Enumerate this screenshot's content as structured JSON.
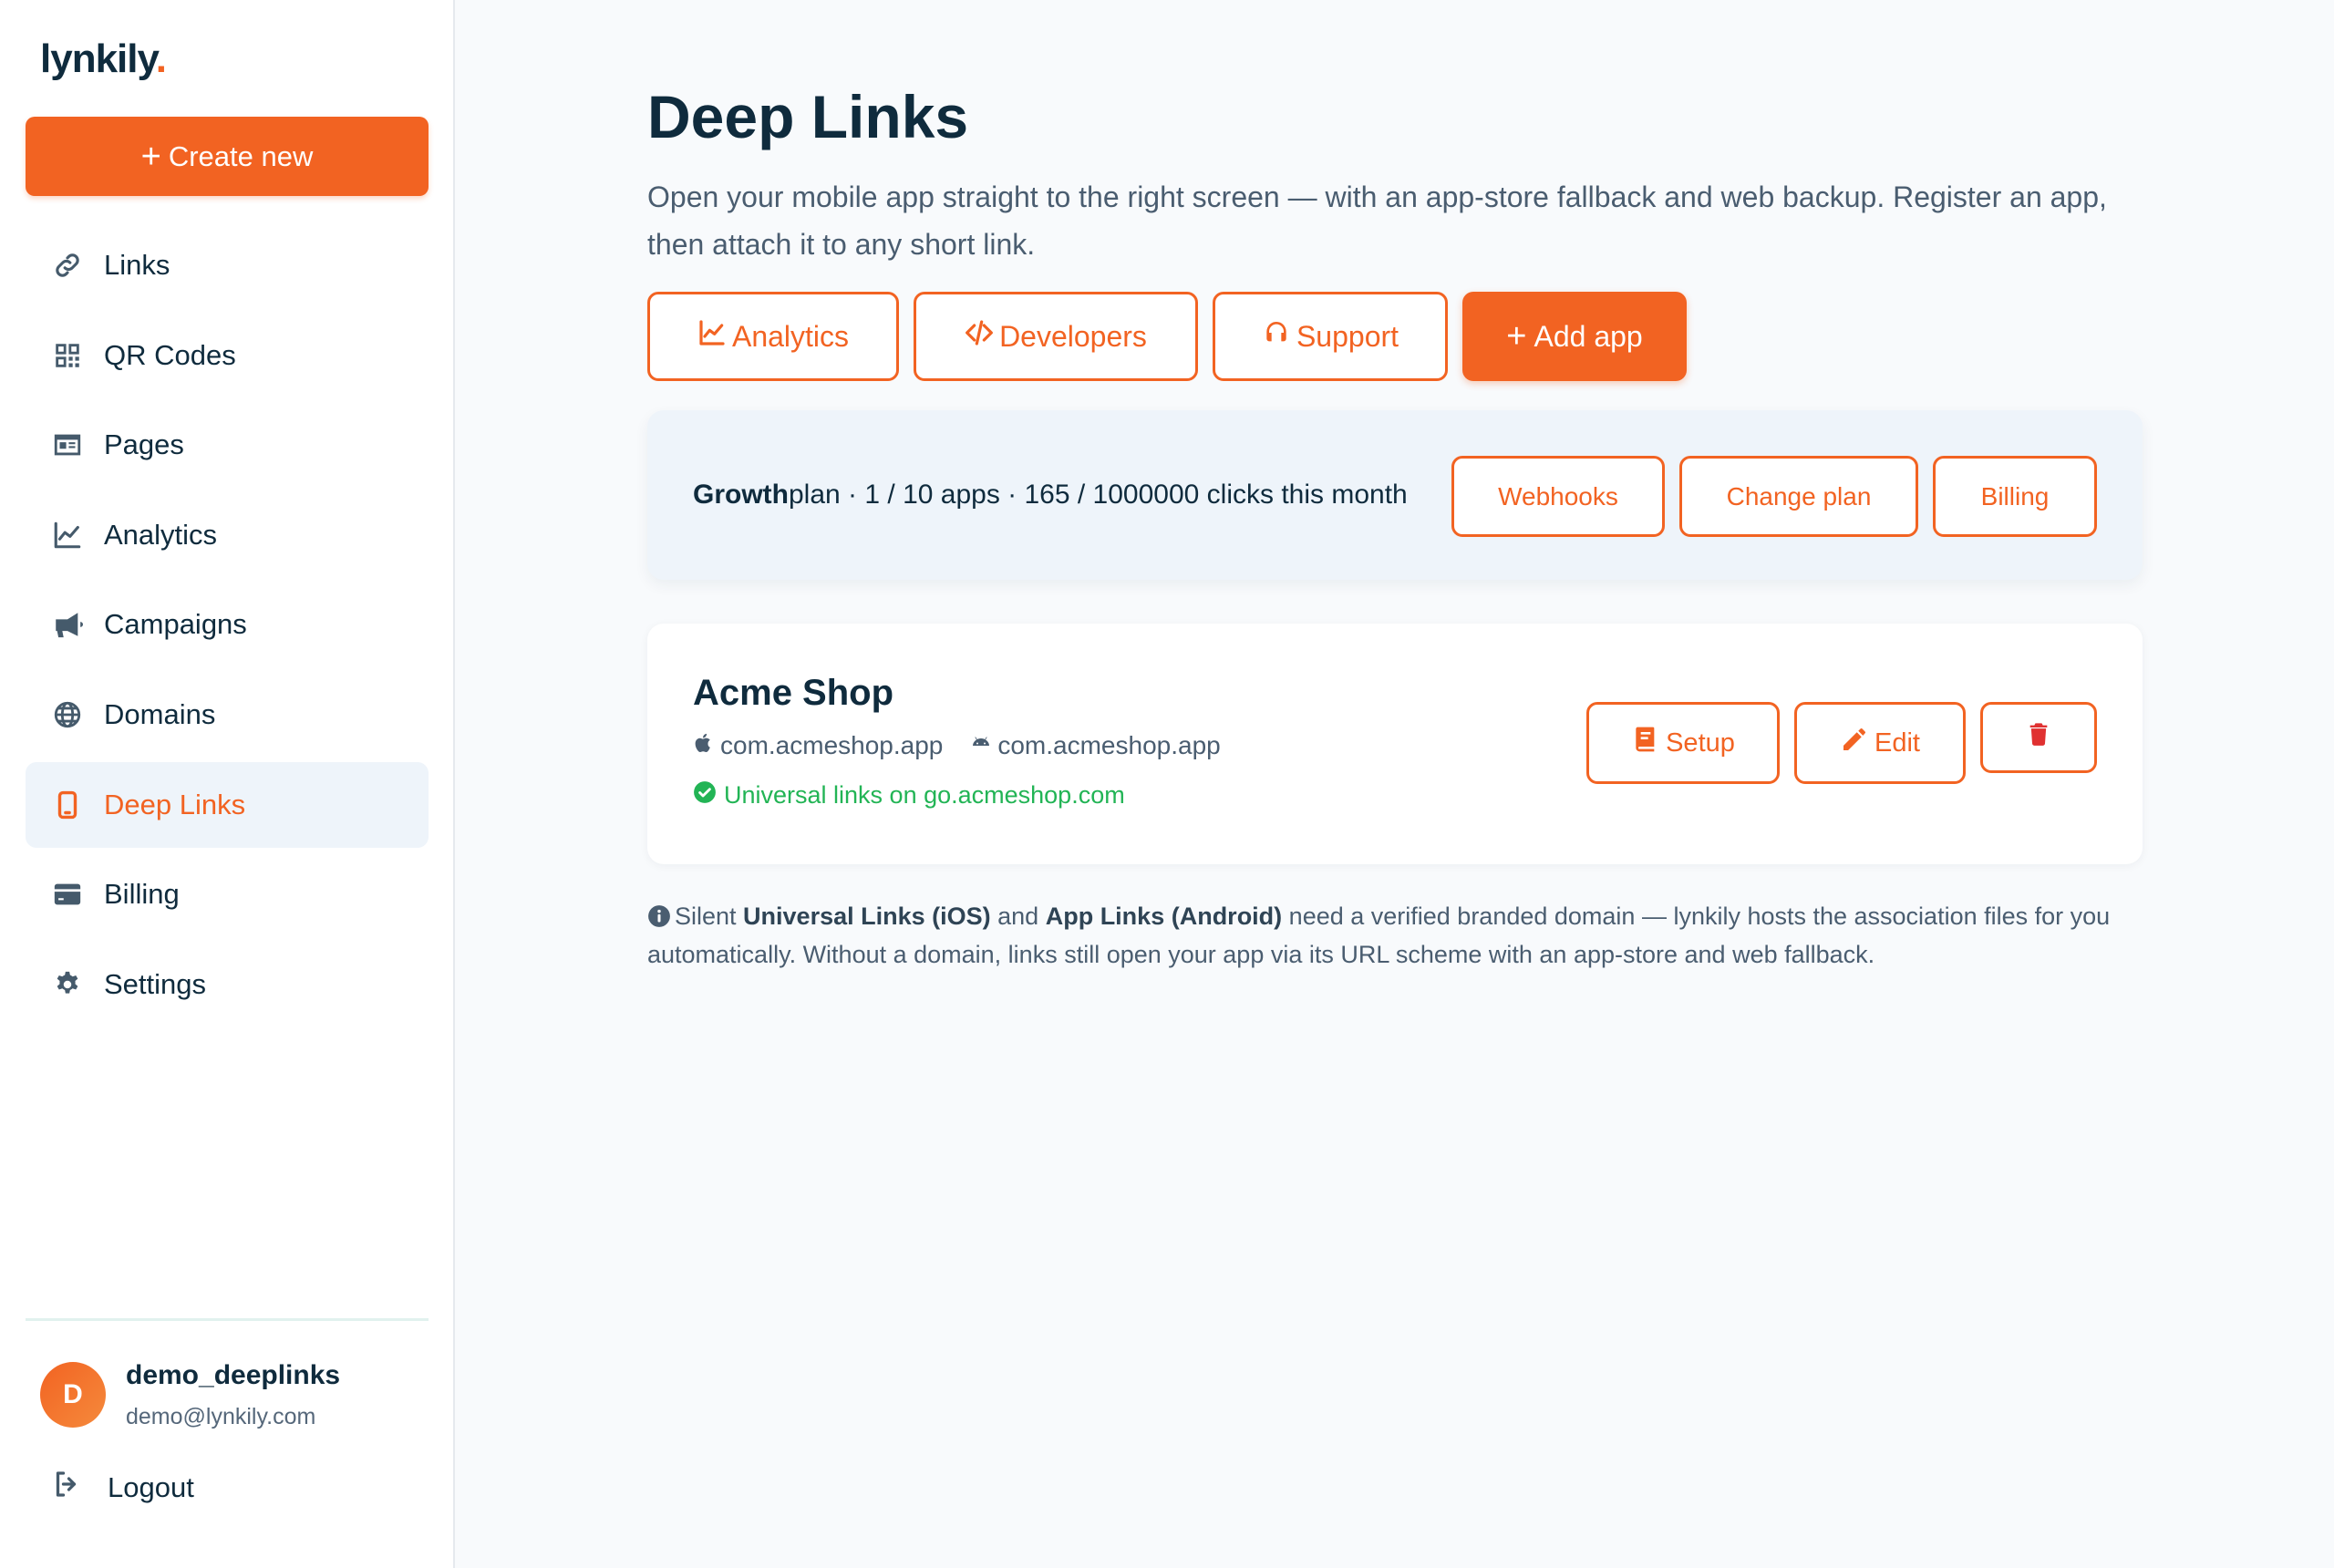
{
  "brand": {
    "name": "lynkily",
    "dot": "."
  },
  "sidebar": {
    "create_label": "Create new",
    "items": [
      {
        "label": "Links",
        "icon": "link-icon",
        "active": false
      },
      {
        "label": "QR Codes",
        "icon": "qr-code-icon",
        "active": false
      },
      {
        "label": "Pages",
        "icon": "id-card-icon",
        "active": false
      },
      {
        "label": "Analytics",
        "icon": "chart-line-icon",
        "active": false
      },
      {
        "label": "Campaigns",
        "icon": "megaphone-icon",
        "active": false
      },
      {
        "label": "Domains",
        "icon": "globe-icon",
        "active": false
      },
      {
        "label": "Deep Links",
        "icon": "mobile-icon",
        "active": true
      },
      {
        "label": "Billing",
        "icon": "credit-card-icon",
        "active": false
      },
      {
        "label": "Settings",
        "icon": "gear-icon",
        "active": false
      }
    ],
    "user": {
      "initial": "D",
      "name": "demo_deeplinks",
      "email": "demo@lynkily.com"
    },
    "logout_label": "Logout"
  },
  "page": {
    "title": "Deep Links",
    "subtitle": "Open your mobile app straight to the right screen — with an app-store fallback and web backup. Register an app, then attach it to any short link.",
    "actions": {
      "analytics": "Analytics",
      "developers": "Developers",
      "support": "Support",
      "add_app": "Add app"
    }
  },
  "plan": {
    "name": "Growth",
    "suffix": " plan · 1 / 10 apps · 165 / 1000000 clicks this month",
    "buttons": {
      "webhooks": "Webhooks",
      "change_plan": "Change plan",
      "billing": "Billing"
    }
  },
  "app": {
    "name": "Acme Shop",
    "ios_package": "com.acmeshop.app",
    "android_package": "com.acmeshop.app",
    "universal_status": "Universal links on go.acmeshop.com",
    "buttons": {
      "setup": "Setup",
      "edit": "Edit"
    }
  },
  "note": {
    "p1": "Silent ",
    "b1": "Universal Links (iOS)",
    "p2": " and ",
    "b2": "App Links (Android)",
    "p3": " need a verified branded domain — lynkily hosts the association files for you automatically. Without a domain, links still open your app via its URL scheme with an app-store and web fallback."
  },
  "colors": {
    "accent": "#f26322",
    "success": "#22b455",
    "text": "#0f2b3d",
    "muted": "#4a5d70",
    "danger": "#e03131"
  }
}
